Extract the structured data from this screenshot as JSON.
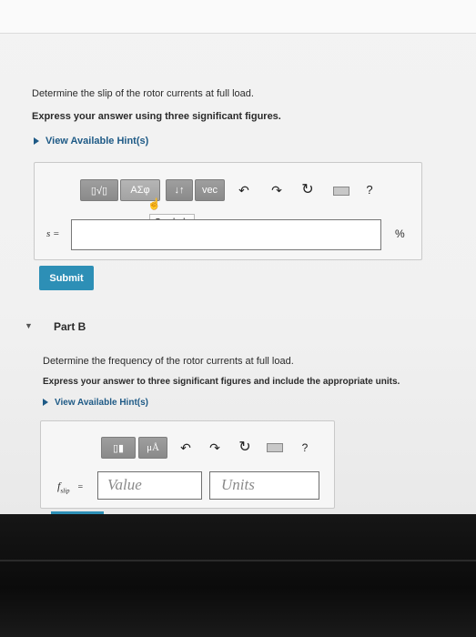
{
  "partA": {
    "question": "Determine the slip of the rotor currents at full load.",
    "instruction": "Express your answer using three significant figures.",
    "hint_link": "View Available Hint(s)",
    "toolbar": {
      "templates_glyph": "▯√▯",
      "symbols_label": "ΑΣφ",
      "arrows_glyph": "↓↑",
      "vec_label": "vec",
      "undo_glyph": "↶",
      "redo_glyph": "↷",
      "reset_glyph": "↻",
      "help_glyph": "?",
      "tooltip": "Symbols"
    },
    "variable_label": "s =",
    "unit_label": "%",
    "answer_value": "",
    "submit_label": "Submit"
  },
  "partB": {
    "title": "Part B",
    "question": "Determine the frequency of the rotor currents at full load.",
    "instruction": "Express your answer to three significant figures and include the appropriate units.",
    "hint_link": "View Available Hint(s)",
    "toolbar": {
      "templates_glyph": "▯▮",
      "units_label": "μÅ",
      "undo_glyph": "↶",
      "redo_glyph": "↷",
      "reset_glyph": "↻",
      "help_glyph": "?"
    },
    "variable_label": "f",
    "variable_sub": "slip",
    "equals": "=",
    "value_placeholder": "Value",
    "units_placeholder": "Units"
  },
  "colors": {
    "submit": "#2d8fb6",
    "hint_link": "#1e5a86",
    "tool_button": "#939393"
  }
}
